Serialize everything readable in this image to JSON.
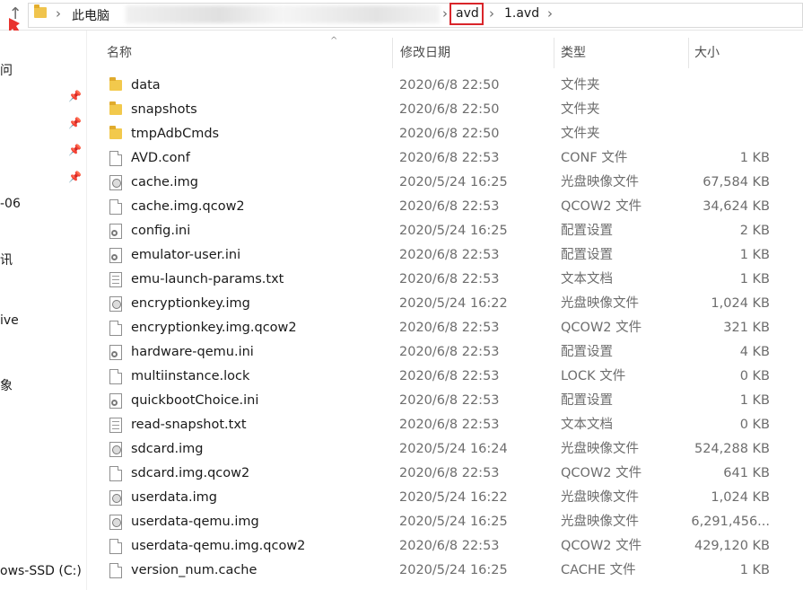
{
  "address": {
    "crumbs": [
      "此电脑",
      "avd",
      "1.avd"
    ]
  },
  "nav": {
    "items": [
      "问",
      "-06",
      "讯",
      "ive",
      "象",
      "ows-SSD (C:)"
    ]
  },
  "columns": {
    "name": "名称",
    "date": "修改日期",
    "type": "类型",
    "size": "大小"
  },
  "files": [
    {
      "name": "data",
      "date": "2020/6/8 22:50",
      "type": "文件夹",
      "size": "",
      "icon": "folder-icon"
    },
    {
      "name": "snapshots",
      "date": "2020/6/8 22:50",
      "type": "文件夹",
      "size": "",
      "icon": "folder-icon"
    },
    {
      "name": "tmpAdbCmds",
      "date": "2020/6/8 22:50",
      "type": "文件夹",
      "size": "",
      "icon": "folder-icon"
    },
    {
      "name": "AVD.conf",
      "date": "2020/6/8 22:53",
      "type": "CONF 文件",
      "size": "1 KB",
      "icon": "file-icon"
    },
    {
      "name": "cache.img",
      "date": "2020/5/24 16:25",
      "type": "光盘映像文件",
      "size": "67,584 KB",
      "icon": "disc-image-icon"
    },
    {
      "name": "cache.img.qcow2",
      "date": "2020/6/8 22:53",
      "type": "QCOW2 文件",
      "size": "34,624 KB",
      "icon": "file-icon"
    },
    {
      "name": "config.ini",
      "date": "2020/5/24 16:25",
      "type": "配置设置",
      "size": "2 KB",
      "icon": "settings-file-icon"
    },
    {
      "name": "emulator-user.ini",
      "date": "2020/6/8 22:53",
      "type": "配置设置",
      "size": "1 KB",
      "icon": "settings-file-icon"
    },
    {
      "name": "emu-launch-params.txt",
      "date": "2020/6/8 22:53",
      "type": "文本文档",
      "size": "1 KB",
      "icon": "text-file-icon"
    },
    {
      "name": "encryptionkey.img",
      "date": "2020/5/24 16:22",
      "type": "光盘映像文件",
      "size": "1,024 KB",
      "icon": "disc-image-icon"
    },
    {
      "name": "encryptionkey.img.qcow2",
      "date": "2020/6/8 22:53",
      "type": "QCOW2 文件",
      "size": "321 KB",
      "icon": "file-icon"
    },
    {
      "name": "hardware-qemu.ini",
      "date": "2020/6/8 22:53",
      "type": "配置设置",
      "size": "4 KB",
      "icon": "settings-file-icon"
    },
    {
      "name": "multiinstance.lock",
      "date": "2020/6/8 22:53",
      "type": "LOCK 文件",
      "size": "0 KB",
      "icon": "file-icon"
    },
    {
      "name": "quickbootChoice.ini",
      "date": "2020/6/8 22:53",
      "type": "配置设置",
      "size": "1 KB",
      "icon": "settings-file-icon"
    },
    {
      "name": "read-snapshot.txt",
      "date": "2020/6/8 22:53",
      "type": "文本文档",
      "size": "0 KB",
      "icon": "text-file-icon"
    },
    {
      "name": "sdcard.img",
      "date": "2020/5/24 16:24",
      "type": "光盘映像文件",
      "size": "524,288 KB",
      "icon": "disc-image-icon"
    },
    {
      "name": "sdcard.img.qcow2",
      "date": "2020/6/8 22:53",
      "type": "QCOW2 文件",
      "size": "641 KB",
      "icon": "file-icon"
    },
    {
      "name": "userdata.img",
      "date": "2020/5/24 16:22",
      "type": "光盘映像文件",
      "size": "1,024 KB",
      "icon": "disc-image-icon"
    },
    {
      "name": "userdata-qemu.img",
      "date": "2020/5/24 16:25",
      "type": "光盘映像文件",
      "size": "6,291,456...",
      "icon": "disc-image-icon"
    },
    {
      "name": "userdata-qemu.img.qcow2",
      "date": "2020/6/8 22:53",
      "type": "QCOW2 文件",
      "size": "429,120 KB",
      "icon": "file-icon"
    },
    {
      "name": "version_num.cache",
      "date": "2020/5/24 16:25",
      "type": "CACHE 文件",
      "size": "1 KB",
      "icon": "file-icon"
    }
  ],
  "colors": {
    "highlight_border": "#d9252a",
    "folder": "#f2c94c",
    "muted_text": "#6d6d6d"
  }
}
